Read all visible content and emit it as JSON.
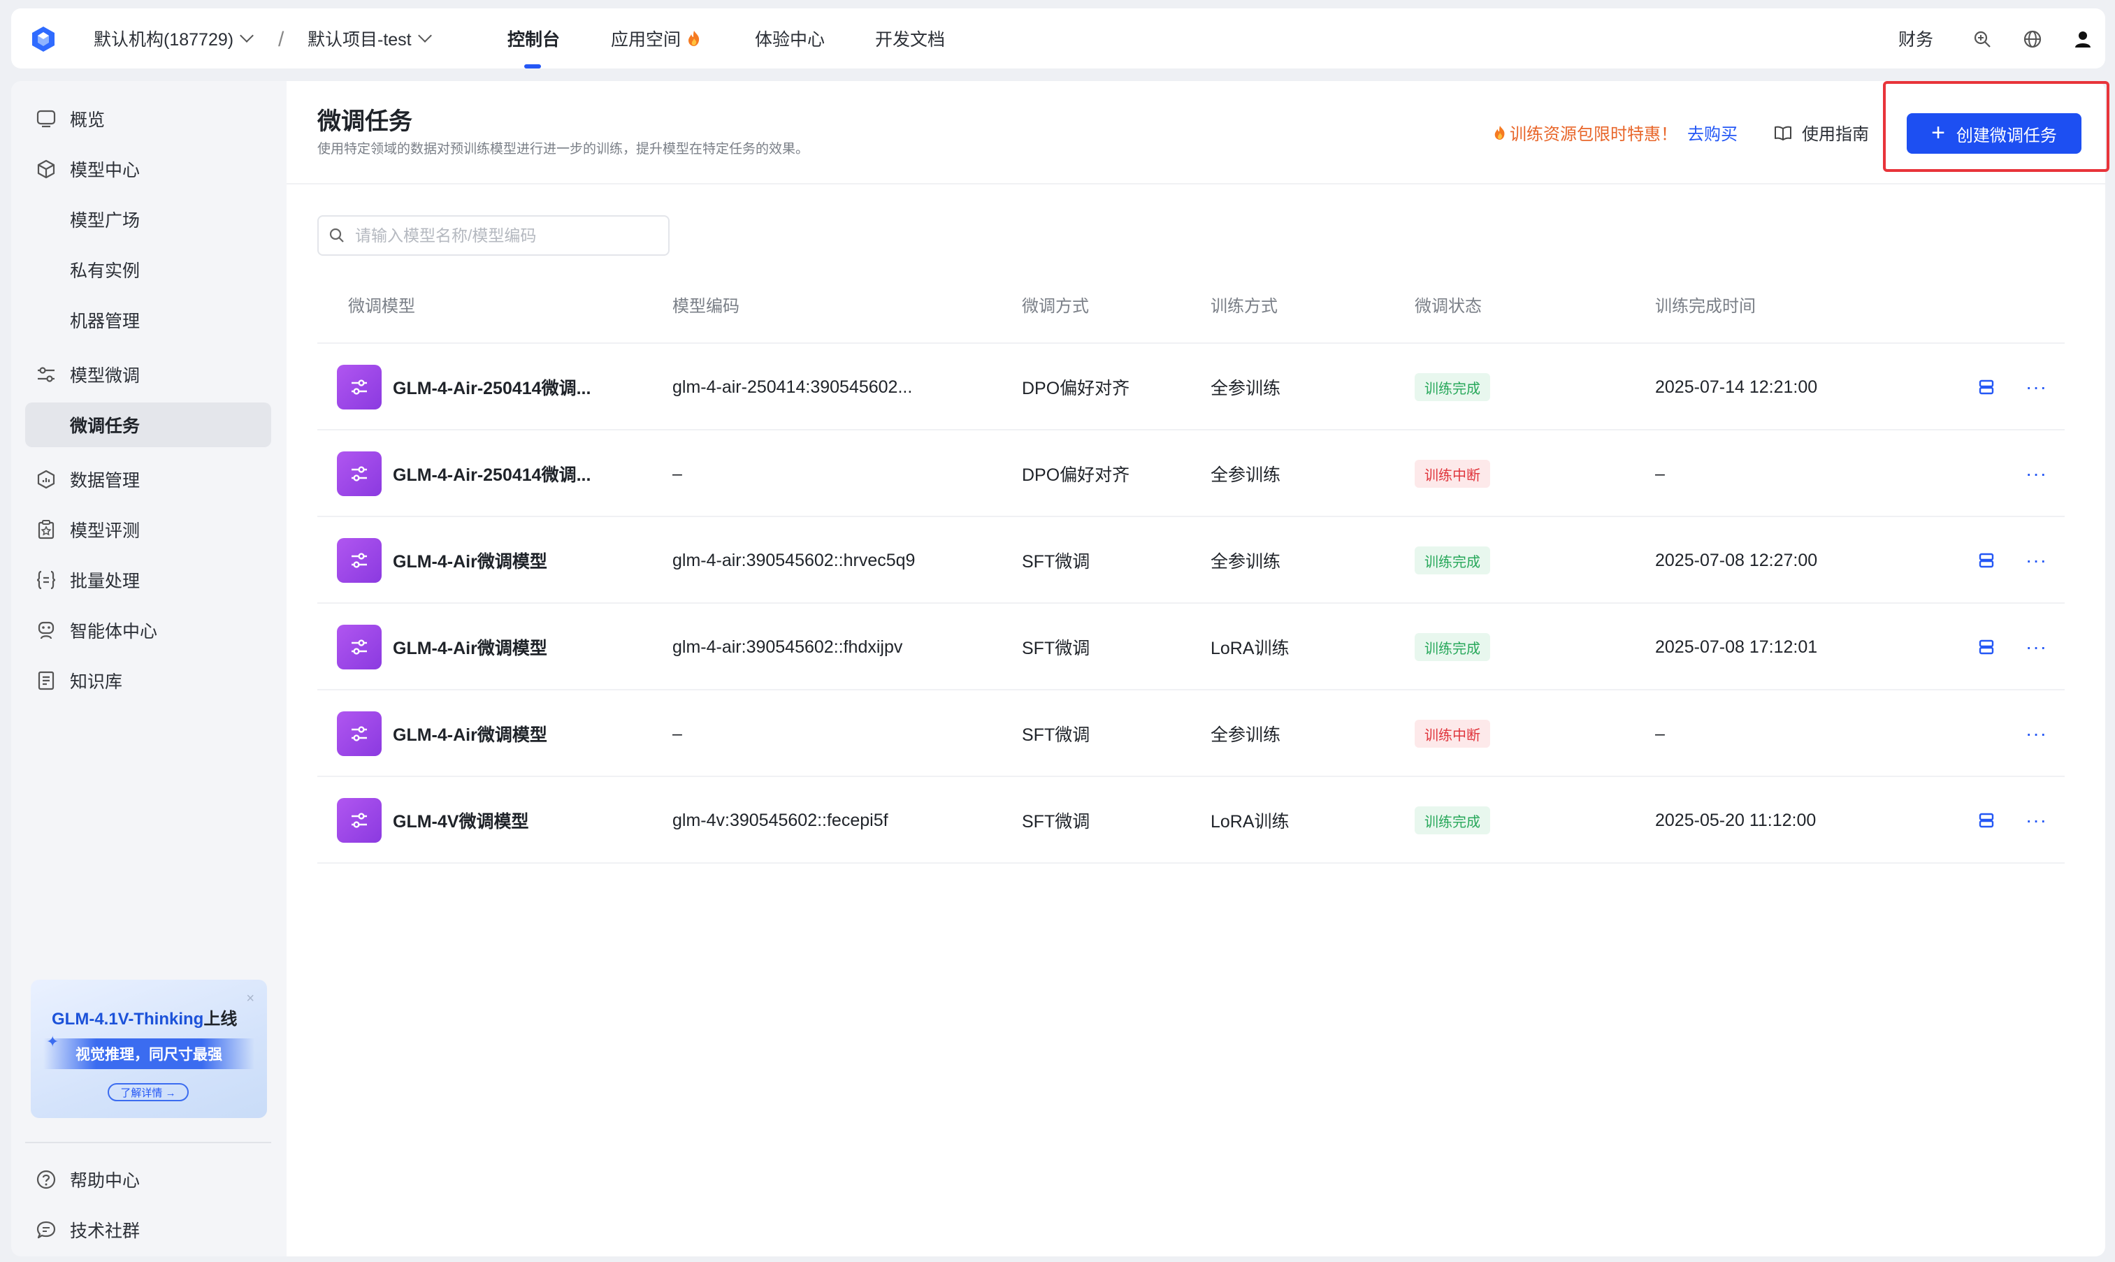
{
  "topbar": {
    "org": "默认机构(187729)",
    "project": "默认项目-test",
    "nav": [
      "控制台",
      "应用空间",
      "体验中心",
      "开发文档"
    ],
    "right": {
      "finance": "财务"
    }
  },
  "sidebar": {
    "items": [
      {
        "label": "概览",
        "icon": "overview-icon"
      },
      {
        "label": "模型中心",
        "icon": "cube-icon"
      },
      {
        "label": "模型广场"
      },
      {
        "label": "私有实例"
      },
      {
        "label": "机器管理"
      },
      {
        "label": "模型微调",
        "icon": "sliders-icon"
      },
      {
        "label": "微调任务"
      },
      {
        "label": "数据管理",
        "icon": "data-icon"
      },
      {
        "label": "模型评测",
        "icon": "evaluate-icon"
      },
      {
        "label": "批量处理",
        "icon": "braces-icon"
      },
      {
        "label": "智能体中心",
        "icon": "agent-icon"
      },
      {
        "label": "知识库",
        "icon": "book-icon"
      }
    ],
    "promo": {
      "title_main": "GLM-4.1V-Thinking",
      "title_suffix": "上线",
      "subtitle": "视觉推理，同尺寸最强",
      "button": "了解详情 →"
    },
    "bottom": [
      {
        "label": "帮助中心",
        "icon": "help-icon"
      },
      {
        "label": "技术社群",
        "icon": "chat-icon"
      }
    ]
  },
  "main": {
    "title": "微调任务",
    "description": "使用特定领域的数据对预训练模型进行进一步的训练，提升模型在特定任务的效果。",
    "promo_text": "训练资源包限时特惠！",
    "promo_link": "去购买",
    "guide": "使用指南",
    "create_button": "创建微调任务",
    "search_placeholder": "请输入模型名称/模型编码",
    "columns": [
      "微调模型",
      "模型编码",
      "微调方式",
      "训练方式",
      "微调状态",
      "训练完成时间"
    ],
    "rows": [
      {
        "name": "GLM-4-Air-250414微调...",
        "code": "glm-4-air-250414:390545602...",
        "method": "DPO偏好对齐",
        "training": "全参训练",
        "status": "训练完成",
        "time": "2025-07-14 12:21:00"
      },
      {
        "name": "GLM-4-Air-250414微调...",
        "code": "–",
        "method": "DPO偏好对齐",
        "training": "全参训练",
        "status": "训练中断",
        "time": "–"
      },
      {
        "name": "GLM-4-Air微调模型",
        "code": "glm-4-air:390545602::hrvec5q9",
        "method": "SFT微调",
        "training": "全参训练",
        "status": "训练完成",
        "time": "2025-07-08 12:27:00"
      },
      {
        "name": "GLM-4-Air微调模型",
        "code": "glm-4-air:390545602::fhdxijpv",
        "method": "SFT微调",
        "training": "LoRA训练",
        "status": "训练完成",
        "time": "2025-07-08 17:12:01"
      },
      {
        "name": "GLM-4-Air微调模型",
        "code": "–",
        "method": "SFT微调",
        "training": "全参训练",
        "status": "训练中断",
        "time": "–"
      },
      {
        "name": "GLM-4V微调模型",
        "code": "glm-4v:390545602::fecepi5f",
        "method": "SFT微调",
        "training": "LoRA训练",
        "status": "训练完成",
        "time": "2025-05-20 11:12:00"
      }
    ],
    "more_glyph": "···"
  },
  "colors": {
    "accent": "#1d4ff2",
    "success": "#28a85b",
    "danger": "#e0363d",
    "highlight": "#e8343a",
    "promo": "#e8662a"
  }
}
